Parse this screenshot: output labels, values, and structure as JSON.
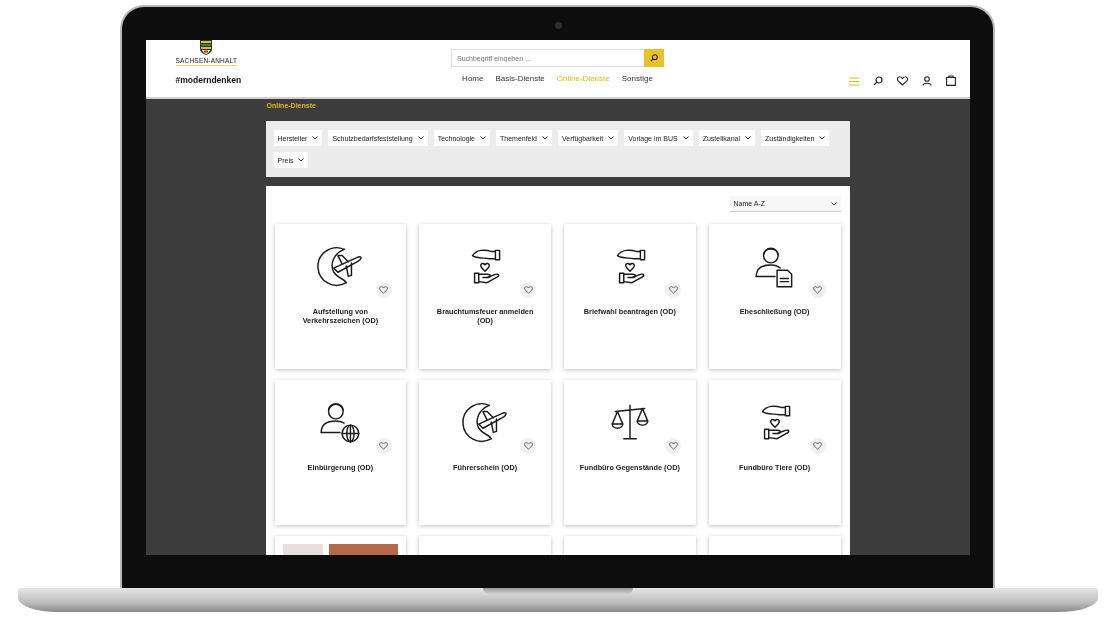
{
  "header": {
    "logo_text": "SACHSEN-ANHALT",
    "slogan": "#moderndenken",
    "search": {
      "placeholder": "Suchbegriff eingeben ..."
    },
    "nav": [
      {
        "label": "Home",
        "selected": false
      },
      {
        "label": "Basis-Dienste",
        "selected": false
      },
      {
        "label": "Online-Dienste",
        "selected": true
      },
      {
        "label": "Sonstige",
        "selected": false
      }
    ]
  },
  "breadcrumb": "Online-Dienste",
  "filters": [
    "Hersteller",
    "Schutzbedarfsfeststellung",
    "Technologie",
    "Themenfeld",
    "Verfügbarkeit",
    "Vorlage im BUS",
    "Zustellkanal",
    "Zuständigkeiten",
    "Preis"
  ],
  "sort": {
    "value": "Name A-Z"
  },
  "cards": [
    {
      "title": "Aufstellung von Verkehrszeichen (OD)",
      "kind": "travel",
      "favorite": false
    },
    {
      "title": "Brauchtumsfeuer anmelden (OD)",
      "kind": "care",
      "favorite": false
    },
    {
      "title": "Briefwahl beantragen (OD)",
      "kind": "care",
      "favorite": false
    },
    {
      "title": "Eheschließung (OD)",
      "kind": "document",
      "favorite": false
    },
    {
      "title": "Einbürgerung (OD)",
      "kind": "citizen",
      "favorite": false
    },
    {
      "title": "Führerschein (OD)",
      "kind": "travel",
      "favorite": false
    },
    {
      "title": "Fundbüro Gegenstände (OD)",
      "kind": "justice",
      "favorite": false
    },
    {
      "title": "Fundbüro Tiere (OD)",
      "kind": "care",
      "favorite": false
    }
  ],
  "partial_cards": [
    {
      "kind": "photo"
    },
    {
      "kind": "blank"
    },
    {
      "kind": "blank"
    },
    {
      "kind": "blank"
    }
  ]
}
